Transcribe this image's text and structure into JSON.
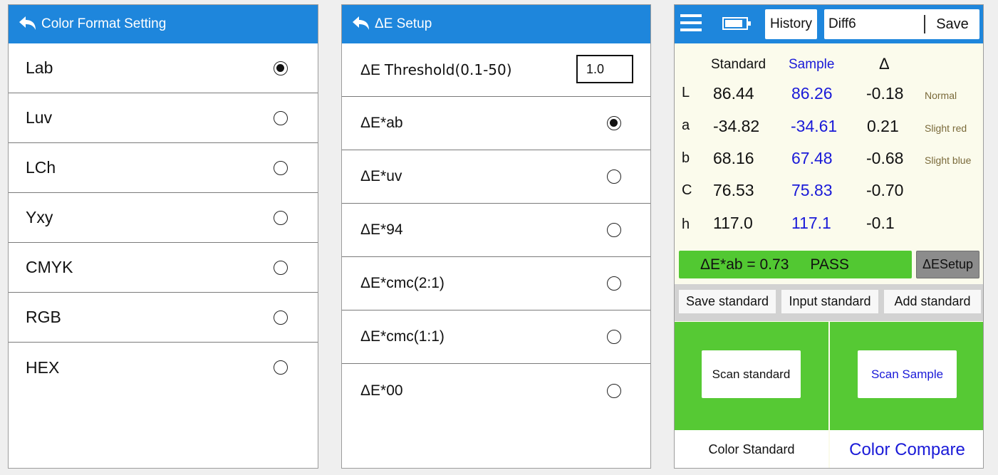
{
  "color_format": {
    "title": "Color Format Setting",
    "options": [
      {
        "label": "Lab",
        "selected": true
      },
      {
        "label": "Luv",
        "selected": false
      },
      {
        "label": "LCh",
        "selected": false
      },
      {
        "label": "Yxy",
        "selected": false
      },
      {
        "label": "CMYK",
        "selected": false
      },
      {
        "label": "RGB",
        "selected": false
      },
      {
        "label": "HEX",
        "selected": false
      }
    ]
  },
  "de_setup": {
    "title": "ΔE Setup",
    "threshold_label_prefix": "ΔE",
    "threshold_label": "Threshold(0.1-50)",
    "threshold_value": "1.0",
    "options": [
      {
        "label": "ΔE*ab",
        "selected": true
      },
      {
        "label": "ΔE*uv",
        "selected": false
      },
      {
        "label": "ΔE*94",
        "selected": false
      },
      {
        "label": "ΔE*cmc(2:1)",
        "selected": false
      },
      {
        "label": "ΔE*cmc(1:1)",
        "selected": false
      },
      {
        "label": "ΔE*00",
        "selected": false
      }
    ]
  },
  "compare": {
    "history_label": "History",
    "sample_name": "Diff6",
    "save_label": "Save",
    "col_standard": "Standard",
    "col_sample": "Sample",
    "col_delta": "Δ",
    "rows": [
      {
        "label": "L",
        "standard": "86.44",
        "sample": "86.26",
        "delta": "-0.18",
        "note": "Normal"
      },
      {
        "label": "a",
        "standard": "-34.82",
        "sample": "-34.61",
        "delta": "0.21",
        "note": "Slight red"
      },
      {
        "label": "b",
        "standard": "68.16",
        "sample": "67.48",
        "delta": "-0.68",
        "note": "Slight blue"
      },
      {
        "label": "C",
        "standard": "76.53",
        "sample": "75.83",
        "delta": "-0.70",
        "note": ""
      },
      {
        "label": "h",
        "standard": "117.0",
        "sample": "117.1",
        "delta": "-0.1",
        "note": ""
      }
    ],
    "result_text": "ΔE*ab = 0.73",
    "result_status": "PASS",
    "de_setup_label": "ΔESetup",
    "save_standard_label": "Save standard",
    "input_standard_label": "Input standard",
    "add_standard_label": "Add standard",
    "scan_standard_label": "Scan standard",
    "scan_sample_label": "Scan Sample",
    "tab_color_standard": "Color Standard",
    "tab_color_compare": "Color Compare"
  },
  "colors": {
    "header_blue": "#1e86dc",
    "pass_green": "#52c832",
    "sample_blue": "#1a1ad8"
  }
}
